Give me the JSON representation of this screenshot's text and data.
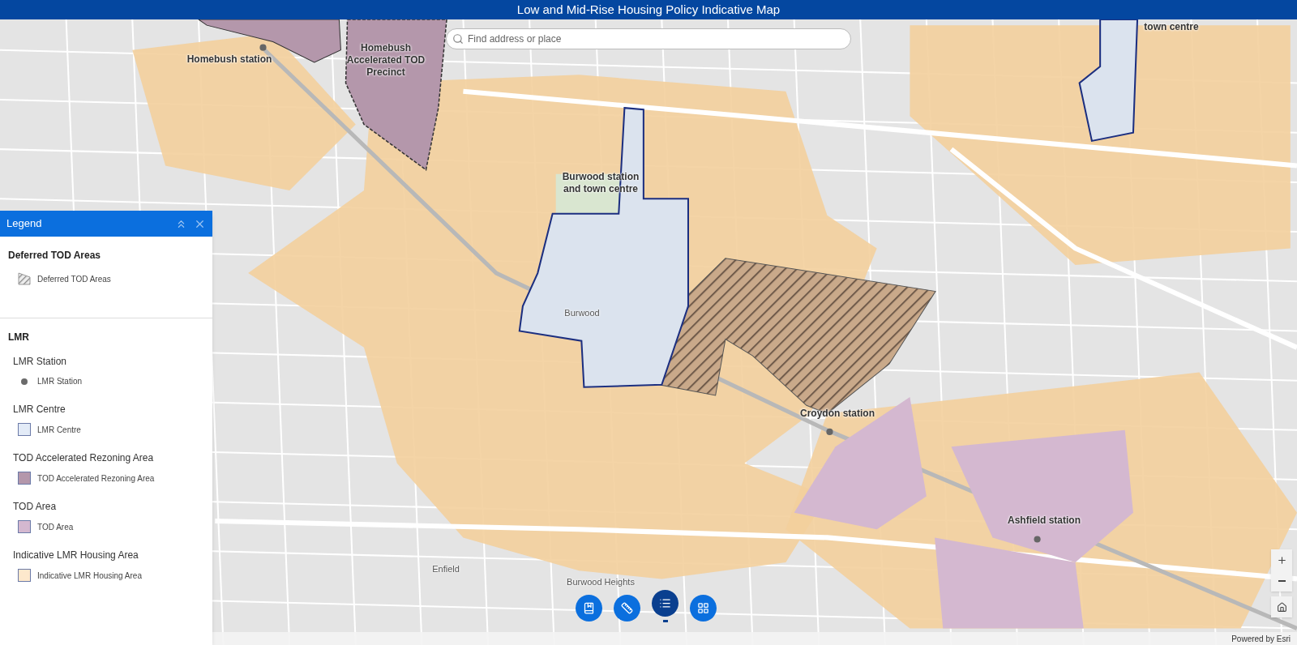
{
  "header": {
    "title": "Low and Mid-Rise Housing Policy Indicative Map"
  },
  "search": {
    "placeholder": "Find address or place"
  },
  "map_labels": [
    {
      "text": "Homebush station",
      "kind": "major"
    },
    {
      "text": "Homebush Accelerated TOD Precinct",
      "kind": "major"
    },
    {
      "text": "town centre",
      "kind": "major"
    },
    {
      "text": "Burwood station and town centre",
      "kind": "major"
    },
    {
      "text": "Burwood",
      "kind": "minor"
    },
    {
      "text": "Croydon station",
      "kind": "major"
    },
    {
      "text": "Ashfield station",
      "kind": "major"
    },
    {
      "text": "Burwood Heights",
      "kind": "minor"
    },
    {
      "text": "Enfield",
      "kind": "minor"
    }
  ],
  "legend": {
    "title": "Legend",
    "groups": [
      {
        "title": "Deferred TOD Areas",
        "layers": [
          {
            "items": [
              {
                "kind": "hatch",
                "label": "Deferred TOD Areas"
              }
            ]
          }
        ]
      },
      {
        "title": "LMR",
        "layers": [
          {
            "title": "LMR Station",
            "items": [
              {
                "kind": "dot",
                "label": "LMR Station",
                "color": "#6b6b6b"
              }
            ]
          },
          {
            "title": "LMR Centre",
            "items": [
              {
                "kind": "swatch",
                "label": "LMR Centre",
                "color": "#e3ebf7"
              }
            ]
          },
          {
            "title": "TOD Accelerated Rezoning Area",
            "items": [
              {
                "kind": "swatch",
                "label": "TOD Accelerated Rezoning Area",
                "color": "#b497ab"
              }
            ]
          },
          {
            "title": "TOD Area",
            "items": [
              {
                "kind": "swatch",
                "label": "TOD Area",
                "color": "#d4b8d0"
              }
            ]
          },
          {
            "title": "Indicative LMR Housing Area",
            "items": [
              {
                "kind": "swatch",
                "label": "Indicative LMR Housing Area",
                "color": "#fde8cc"
              }
            ]
          }
        ]
      }
    ]
  },
  "widgets": [
    {
      "kind": "bookmark",
      "selected": false
    },
    {
      "kind": "measure",
      "selected": false
    },
    {
      "kind": "legend",
      "selected": true
    },
    {
      "kind": "basemap",
      "selected": false
    }
  ],
  "attribution": "Powered by Esri"
}
